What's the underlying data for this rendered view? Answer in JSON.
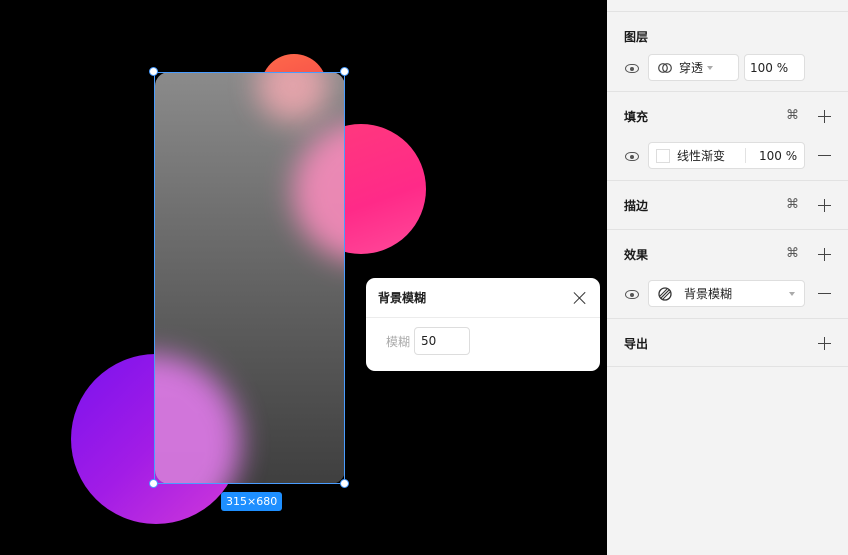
{
  "canvas": {
    "size_badge": "315×680"
  },
  "blur_popup": {
    "title": "背景模糊",
    "label": "模糊",
    "value": "50"
  },
  "panel": {
    "layer": {
      "title": "图层",
      "blend_mode": "穿透",
      "opacity": "100 %"
    },
    "fill": {
      "title": "填充",
      "fill_type": "线性渐变",
      "opacity": "100 %"
    },
    "stroke": {
      "title": "描边"
    },
    "effects": {
      "title": "效果",
      "effect_type": "背景模糊"
    },
    "export": {
      "title": "导出"
    },
    "icon_names": [
      "eye-icon",
      "blend-mode-icon",
      "style-cmd-icon",
      "plus-icon",
      "minus-icon",
      "blur-effect-icon",
      "close-icon"
    ]
  },
  "colors": {
    "selection": "#4a9dff",
    "badge": "#1e8fff",
    "canvas_bg": "#000000",
    "panel_bg": "#f3f3f3"
  }
}
